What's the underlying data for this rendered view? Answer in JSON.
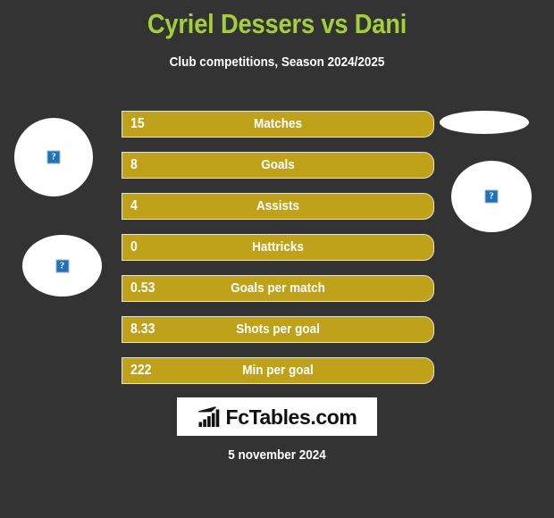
{
  "header": {
    "title": "Cyriel Dessers vs Dani",
    "subtitle": "Club competitions, Season 2024/2025",
    "title_color": "#a6ce39",
    "subtitle_color": "#ffffff"
  },
  "theme": {
    "background": "#333333",
    "bar_color": "#bfa21a",
    "bar_border": "#e8e3cf",
    "text_color": "#ffffff",
    "accent": "#a6ce39"
  },
  "avatars": [
    {
      "name": "home-player-photo-1",
      "side": "left",
      "placeholder": "broken-image-icon",
      "glyph": "?"
    },
    {
      "name": "home-player-photo-2",
      "side": "left",
      "placeholder": "broken-image-icon",
      "glyph": "?"
    },
    {
      "name": "away-player-photo-1",
      "side": "right",
      "placeholder": "broken-image-icon",
      "glyph": ""
    },
    {
      "name": "away-player-photo-2",
      "side": "right",
      "placeholder": "broken-image-icon",
      "glyph": "?"
    }
  ],
  "stats": [
    {
      "label": "Matches",
      "value": "15"
    },
    {
      "label": "Goals",
      "value": "8"
    },
    {
      "label": "Assists",
      "value": "4"
    },
    {
      "label": "Hattricks",
      "value": "0"
    },
    {
      "label": "Goals per match",
      "value": "0.53"
    },
    {
      "label": "Shots per goal",
      "value": "8.33"
    },
    {
      "label": "Min per goal",
      "value": "222"
    }
  ],
  "footer": {
    "logo_text": "FcTables.com",
    "logo_icon": "bar-chart-growth-icon",
    "date": "5 november 2024"
  },
  "chart_data": {
    "type": "table",
    "title": "Cyriel Dessers vs Dani",
    "subtitle": "Club competitions, Season 2024/2025",
    "categories": [
      "Matches",
      "Goals",
      "Assists",
      "Hattricks",
      "Goals per match",
      "Shots per goal",
      "Min per goal"
    ],
    "values": [
      15,
      8,
      4,
      0,
      0.53,
      8.33,
      222
    ],
    "value_labels": [
      "15",
      "8",
      "4",
      "0",
      "0.53",
      "8.33",
      "222"
    ],
    "series": [
      {
        "name": "Cyriel Dessers",
        "values": [
          15,
          8,
          4,
          0,
          0.53,
          8.33,
          222
        ]
      }
    ],
    "xlabel": "",
    "ylabel": "",
    "legend": [
      "Cyriel Dessers",
      "Dani"
    ],
    "grid": false,
    "note": "Horizontal stat comparison bars; each row shows one metric label centered with the numeric value at the left edge."
  }
}
